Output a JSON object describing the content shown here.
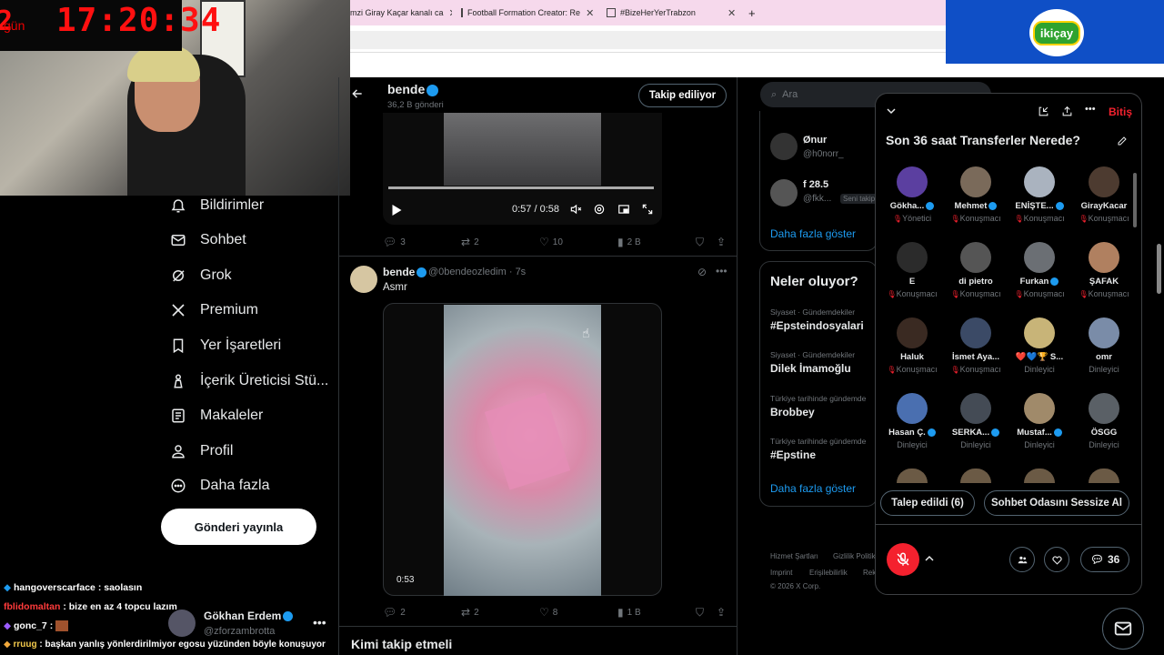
{
  "browser": {
    "tabs": [
      {
        "label": "mzi Giray Kaçar kanalı ca"
      },
      {
        "label": "Football Formation Creator: Re"
      },
      {
        "label": "#BizeHerYerTrabzon"
      }
    ],
    "close_glyph": "✕",
    "new_tab_glyph": "+"
  },
  "sponsor": {
    "logo_text": "ikiçay"
  },
  "webcam": {
    "day_label": "gün",
    "time": "17:20:34",
    "day_number": "2"
  },
  "nav": {
    "items": [
      {
        "label": "Bildirimler",
        "icon": "bell-icon"
      },
      {
        "label": "Sohbet",
        "icon": "mail-icon"
      },
      {
        "label": "Grok",
        "icon": "grok-icon"
      },
      {
        "label": "Premium",
        "icon": "x-icon"
      },
      {
        "label": "Yer İşaretleri",
        "icon": "bookmark-icon"
      },
      {
        "label": "İçerik Üreticisi Stü...",
        "icon": "creator-icon"
      },
      {
        "label": "Makaleler",
        "icon": "article-icon"
      },
      {
        "label": "Profil",
        "icon": "person-icon"
      },
      {
        "label": "Daha fazla",
        "icon": "more-icon"
      }
    ],
    "post_button": "Gönderi yayınla"
  },
  "chat": [
    {
      "user": "hangoverscarface",
      "text": ": saolasın",
      "color": "#ffffff"
    },
    {
      "user": "fblidomaltan",
      "text": ": bize en az 4 topcu lazım",
      "color": "#ff3b3b"
    },
    {
      "user": "gonc_7",
      "text": ":",
      "color": "#ffffff"
    },
    {
      "user": "rruug",
      "text": ": başkan yanlış yönlerdirilmiyor egosu yüzünden böyle konuşuyor",
      "color": "#f2c94c"
    }
  ],
  "account": {
    "name": "Gökhan Erdem",
    "handle": "@zforzambrotta",
    "more": "•••"
  },
  "profile_header": {
    "name": "bende",
    "post_count": "36,2 B gönderi",
    "follow_button": "Takip ediliyor"
  },
  "post1": {
    "video_time": "0:57 / 0:58",
    "replies": "3",
    "reposts": "2",
    "likes": "10",
    "views": "2 B"
  },
  "post2": {
    "name": "bende",
    "handle": "@0bendeozledim",
    "time": "· 7s",
    "text": "Asmr",
    "video_time": "0:53",
    "replies": "2",
    "reposts": "2",
    "likes": "8",
    "views": "1 B"
  },
  "who_to_follow": "Kimi takip etmeli",
  "right": {
    "search_placeholder": "Ara",
    "suggestions": [
      {
        "name": "Ønur",
        "handle": "@h0norr_"
      },
      {
        "name": "f 28.5",
        "handle": "@fkk...",
        "badge": "Seni takip"
      }
    ],
    "show_more": "Daha fazla göster",
    "trends_title": "Neler oluyor?",
    "trends": [
      {
        "category": "Siyaset · Gündemdekiler",
        "title": "#Epsteindosyalari"
      },
      {
        "category": "Siyaset · Gündemdekiler",
        "title": "Dilek İmamoğlu"
      },
      {
        "category": "Türkiye tarihinde gündemde",
        "title": "Brobbey"
      },
      {
        "category": "Türkiye tarihinde gündemde",
        "title": "#Epstine"
      }
    ],
    "show_more_2": "Daha fazla göster",
    "footer": [
      "Hizmet Şartları",
      "Gizlilik Politik",
      "Imprint",
      "Erişilebilirlik",
      "Rek",
      "© 2026 X Corp."
    ]
  },
  "space": {
    "title": "Son 36 saat Transferler Nerede?",
    "end_label": "Bitiş",
    "participants": [
      {
        "name": "Gökha...",
        "role": "Yönetici",
        "verified": true,
        "color": "#5b3fa0"
      },
      {
        "name": "Mehmet",
        "role": "Konuşmacı",
        "verified": true,
        "color": "#7a6a5a"
      },
      {
        "name": "ENİŞTE...",
        "role": "Konuşmacı",
        "verified": true,
        "color": "#aab3bf"
      },
      {
        "name": "GirayKacar",
        "role": "Konuşmacı",
        "verified": false,
        "color": "#4d3b30"
      },
      {
        "name": "E",
        "role": "Konuşmacı",
        "verified": false,
        "color": "#2b2b2b"
      },
      {
        "name": "di pietro",
        "role": "Konuşmacı",
        "verified": false,
        "color": "#555555"
      },
      {
        "name": "Furkan",
        "role": "Konuşmacı",
        "verified": true,
        "color": "#6b6f74"
      },
      {
        "name": "ŞAFAK",
        "role": "Konuşmacı",
        "verified": false,
        "color": "#b08060"
      },
      {
        "name": "Haluk",
        "role": "Konuşmacı",
        "verified": false,
        "color": "#3a2a22"
      },
      {
        "name": "İsmet Aya...",
        "role": "Konuşmacı",
        "verified": false,
        "color": "#3b4a66"
      },
      {
        "name": "❤️💙🏆 S...",
        "role": "Dinleyici",
        "verified": false,
        "color": "#c8b478"
      },
      {
        "name": "omr",
        "role": "Dinleyici",
        "verified": false,
        "color": "#7a8ca8"
      },
      {
        "name": "Hasan Ç.",
        "role": "Dinleyici",
        "verified": true,
        "color": "#4a6fb0"
      },
      {
        "name": "SERKA...",
        "role": "Dinleyici",
        "verified": true,
        "color": "#444b55"
      },
      {
        "name": "Mustaf...",
        "role": "Dinleyici",
        "verified": true,
        "color": "#a08a6a"
      },
      {
        "name": "ÖSGG",
        "role": "Dinleyici",
        "verified": false,
        "color": "#5a6066"
      }
    ],
    "request_button": "Talep edildi (6)",
    "mute_button": "Sohbet Odasını Sessize Al",
    "comments_count": "36"
  }
}
